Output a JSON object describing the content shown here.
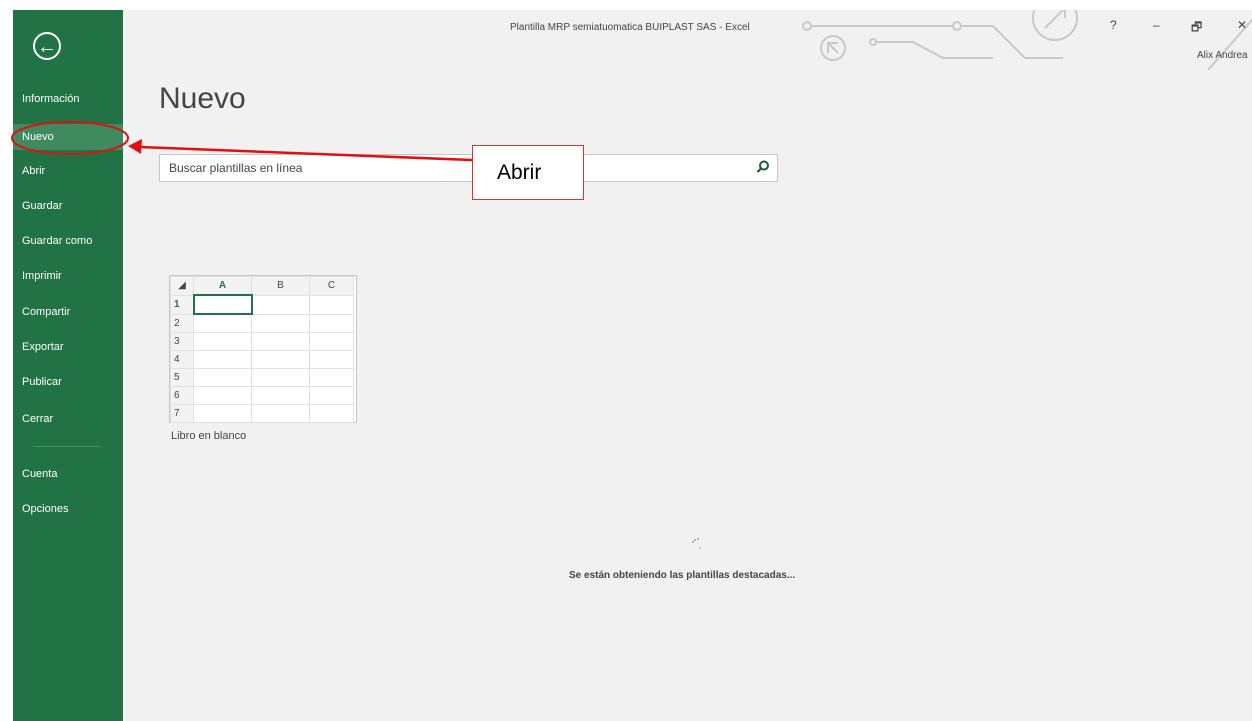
{
  "app": {
    "window_title": "Plantilla MRP semiatuomatica BUIPLAST SAS - Excel",
    "user_name": "Alix Andrea",
    "help_glyph": "?",
    "minimize_glyph": "–",
    "restore_glyph": "🗗",
    "close_glyph": "✕"
  },
  "sidebar": {
    "back_icon": "←",
    "items": [
      {
        "label": "Información"
      },
      {
        "label": "Nuevo",
        "selected": true
      },
      {
        "label": "Abrir"
      },
      {
        "label": "Guardar"
      },
      {
        "label": "Guardar como"
      },
      {
        "label": "Imprimir"
      },
      {
        "label": "Compartir"
      },
      {
        "label": "Exportar"
      },
      {
        "label": "Publicar"
      },
      {
        "label": "Cerrar"
      },
      {
        "label": "Cuenta"
      },
      {
        "label": "Opciones"
      }
    ]
  },
  "main": {
    "title": "Nuevo",
    "search": {
      "placeholder": "Buscar plantillas en línea",
      "icon": "search-icon"
    },
    "blank_workbook": {
      "label": "Libro en blanco",
      "columns": [
        "A",
        "B",
        "C"
      ],
      "rows": [
        "1",
        "2",
        "3",
        "4",
        "5",
        "6",
        "7"
      ]
    },
    "loading_text": "Se están obteniendo las plantillas destacadas..."
  },
  "annotation": {
    "callout_text": "Abrir",
    "color": "#e01010"
  },
  "colors": {
    "sidebar": "#217346",
    "selected": "#3f8b5f",
    "background": "#f1f1f1"
  }
}
